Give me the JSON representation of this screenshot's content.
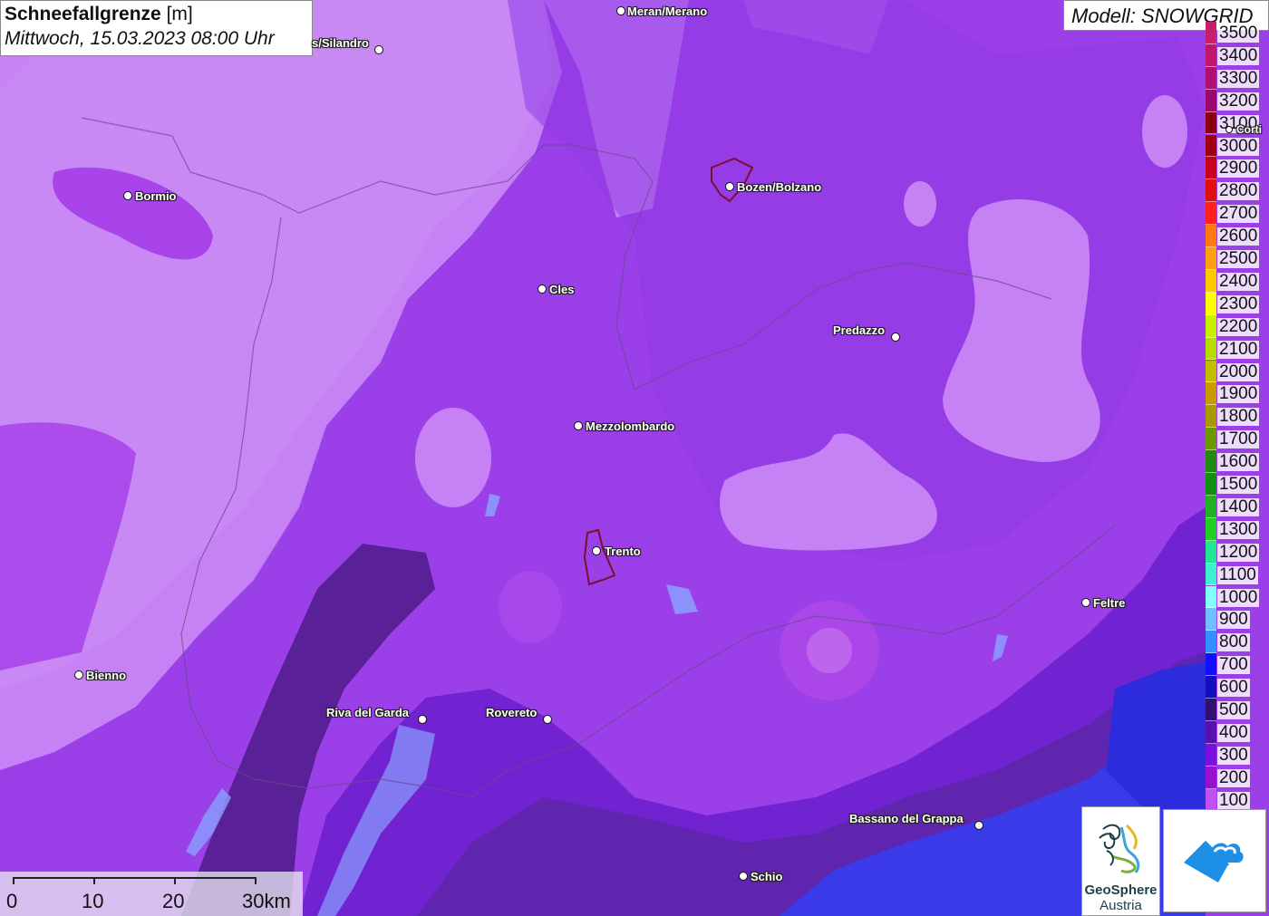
{
  "header": {
    "title_bold": "Schneefallgrenze",
    "title_unit": "[m]",
    "datetime": "Mittwoch, 15.03.2023 08:00 Uhr"
  },
  "model_label": "Modell: SNOWGRID",
  "legend": {
    "values": [
      "3500",
      "3400",
      "3300",
      "3200",
      "3100",
      "3000",
      "2900",
      "2800",
      "2700",
      "2600",
      "2500",
      "2400",
      "2300",
      "2200",
      "2100",
      "2000",
      "1900",
      "1800",
      "1700",
      "1600",
      "1500",
      "1400",
      "1300",
      "1200",
      "1100",
      "1000",
      "900",
      "800",
      "700",
      "600",
      "500",
      "400",
      "300",
      "200",
      "100"
    ],
    "colors": [
      "#c81e6e",
      "#c0176a",
      "#b01070",
      "#9a0a6a",
      "#8a0010",
      "#a00010",
      "#c8001e",
      "#e01010",
      "#ff2020",
      "#ff7a10",
      "#ffa010",
      "#ffc800",
      "#ffff00",
      "#c8f000",
      "#b8dc00",
      "#c0c000",
      "#c89a00",
      "#a89a00",
      "#6a9a00",
      "#208a10",
      "#109010",
      "#20b020",
      "#20d020",
      "#20e890",
      "#40f0d0",
      "#80ffff",
      "#70c0ff",
      "#3090ff",
      "#1010ff",
      "#1010c0",
      "#301070",
      "#5a10b0",
      "#7a10e0",
      "#9a10d0",
      "#c050f0"
    ]
  },
  "cities": [
    {
      "name": "Meran/Merano"
    },
    {
      "name": "s/Silandro"
    },
    {
      "name": "Bormio"
    },
    {
      "name": "Bozen/Bolzano"
    },
    {
      "name": "Cles"
    },
    {
      "name": "Predazzo"
    },
    {
      "name": "Mezzolombardo"
    },
    {
      "name": "Trento"
    },
    {
      "name": "Feltre"
    },
    {
      "name": "Bienno"
    },
    {
      "name": "Riva del Garda"
    },
    {
      "name": "Rovereto"
    },
    {
      "name": "Bassano del Grappa"
    },
    {
      "name": "Schio"
    },
    {
      "name": "Corti"
    }
  ],
  "scale": {
    "labels": [
      "0",
      "10",
      "20",
      "30km"
    ]
  },
  "logos": {
    "geosphere_line1": "GeoSphere",
    "geosphere_line2": "Austria"
  },
  "colors": {
    "snowline_high": "#c98af5",
    "snowline_mid": "#a044ee",
    "snowline_low": "#7a22e0",
    "snowline_lowest": "#5a1ea0"
  }
}
